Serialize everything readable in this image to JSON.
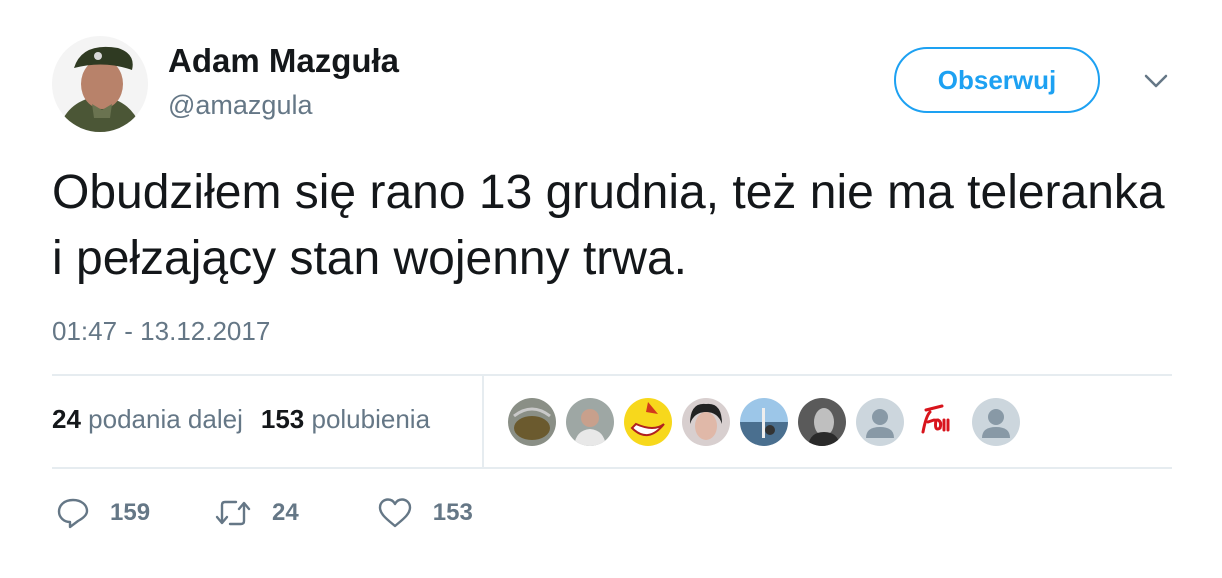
{
  "author": {
    "name": "Adam Mazguła",
    "handle": "@amazgula"
  },
  "follow_button_label": "Obserwuj",
  "tweet": {
    "text": "Obudziłem się rano 13 grudnia, też nie ma teleranka i pełzający stan wojenny trwa.",
    "timestamp": "01:47 - 13.12.2017"
  },
  "stats": {
    "retweets_count": "24",
    "retweets_label": "podania dalej",
    "likes_count": "153",
    "likes_label": "polubienia"
  },
  "actions": {
    "replies": "159",
    "retweets": "24",
    "likes": "153"
  },
  "liker_avatars": [
    "photo",
    "photo",
    "cartoon",
    "photo",
    "photo",
    "photo",
    "default",
    "logo",
    "default"
  ],
  "colors": {
    "accent": "#1da1f2",
    "secondary_text": "#657786",
    "primary_text": "#14171a",
    "divider": "#e6ecf0"
  }
}
